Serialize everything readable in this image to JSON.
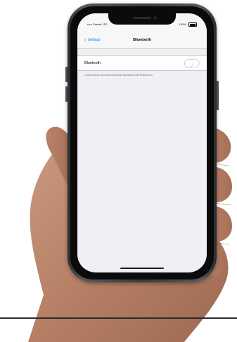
{
  "status_bar": {
    "carrier": "••••• Carrier LTE",
    "time": "12:34",
    "battery_label": "100%",
    "battery_level": 0.8
  },
  "nav_bar": {
    "back_label": "Settings",
    "title": "Bluetooth"
  },
  "bluetooth": {
    "label": "Bluetooth",
    "toggle_on": false,
    "footnote": "Locate devices and connect Bluetooth accessories with Bluetooth on."
  },
  "colors": {
    "accent": "#007aff",
    "background": "#efeff4",
    "bar": "#f7f7f7",
    "separator": "#c8c7cc"
  },
  "icons": {
    "back": "chevron-left-icon",
    "battery": "battery-icon"
  }
}
